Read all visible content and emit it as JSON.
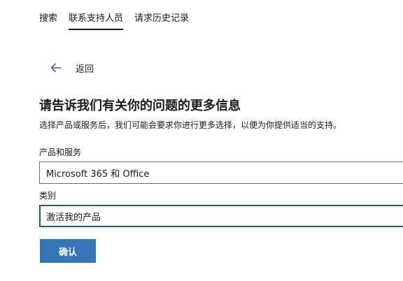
{
  "tabs": [
    {
      "label": "搜索",
      "active": false
    },
    {
      "label": "联系支持人员",
      "active": true
    },
    {
      "label": "请求历史记录",
      "active": false
    }
  ],
  "back": {
    "label": "返回",
    "icon": "arrow-left-icon"
  },
  "form": {
    "heading": "请告诉我们有关你的问题的更多信息",
    "subtext": "选择产品或服务后，我们可能会要求你进行更多选择，以便为你提供适当的支持。",
    "product_label": "产品和服务",
    "product_value": "Microsoft 365 和 Office",
    "category_label": "类别",
    "category_value": "激活我的产品",
    "confirm_label": "确认"
  },
  "colors": {
    "accent": "#3276b8",
    "focus_border": "#1c5d8a",
    "back_arrow": "#3a6e9e"
  }
}
